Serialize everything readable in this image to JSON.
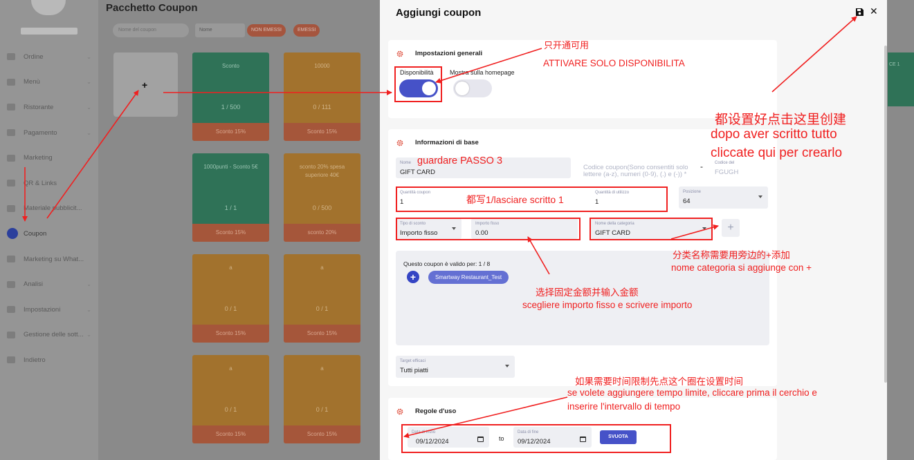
{
  "sidebar": {
    "items": [
      {
        "label": "Ordine",
        "chevron": true
      },
      {
        "label": "Menù",
        "chevron": true
      },
      {
        "label": "Ristorante",
        "chevron": true
      },
      {
        "label": "Pagamento",
        "chevron": true
      },
      {
        "label": "Marketing",
        "chevron": true
      },
      {
        "label": "QR & Links",
        "chevron": false
      },
      {
        "label": "Materiale pubblicit...",
        "chevron": false
      },
      {
        "label": "Coupon",
        "chevron": false,
        "active": true
      },
      {
        "label": "Marketing su What...",
        "chevron": false
      },
      {
        "label": "Analisi",
        "chevron": true
      },
      {
        "label": "Impostazioni",
        "chevron": true
      },
      {
        "label": "Gestione delle sott...",
        "chevron": true
      },
      {
        "label": "Indietro",
        "chevron": false
      }
    ],
    "chevron_glyph": "⌄"
  },
  "main": {
    "title": "Pacchetto Coupon",
    "search_placeholder": "Nome del coupon",
    "sort_value": "Nome",
    "chip_not_issued": "NON EMESSI",
    "chip_issued": "EMESSI",
    "add_card_plus": "+",
    "right_edge_title": "CE 1",
    "cards": [
      {
        "title": "Sconto",
        "count": "1 / 500",
        "bottom": "Sconto 15%",
        "color": "green"
      },
      {
        "title": "10000",
        "count": "0 / 111",
        "bottom": "Sconto 15%",
        "color": "orange"
      },
      {
        "title": "1000punti - Sconto 5€",
        "count": "1 / 1",
        "bottom": "Sconto 15%",
        "color": "green"
      },
      {
        "title": "sconto 20% spesa superiore 40€",
        "count": "0 / 500",
        "bottom": "sconto 20%",
        "color": "orange"
      },
      {
        "title": "a",
        "count": "0 / 1",
        "bottom": "Sconto 15%",
        "color": "orange"
      },
      {
        "title": "a",
        "count": "0 / 1",
        "bottom": "Sconto 15%",
        "color": "orange"
      },
      {
        "title": "a",
        "count": "0 / 1",
        "bottom": "Sconto 15%",
        "color": "orange"
      },
      {
        "title": "a",
        "count": "0 / 1",
        "bottom": "Sconto 15%",
        "color": "orange"
      }
    ]
  },
  "drawer": {
    "title": "Aggiungi coupon",
    "close": "✕",
    "general": {
      "title": "Impostazioni generali",
      "availability_label": "Disponibilità",
      "homepage_label": "Mostra sulla homepage"
    },
    "basic": {
      "title": "Informazioni di base",
      "name_label": "Nome",
      "name_value": "GIFT CARD",
      "code_placeholder_line1": "Codice coupon(Sono consentiti solo",
      "code_placeholder_line2": "lettere (a-z), numeri (0-9), (.) e (-)) *",
      "dash": "-",
      "code_suffix_label": "Codice del",
      "code_suffix_value": "FGUGH",
      "quantity_label": "Quantità coupon",
      "quantity_value": "1",
      "usage_label": "Quantità di utilizzo",
      "usage_value": "1",
      "position_label": "Posizione",
      "position_value": "64",
      "discount_type_label": "Tipo di sconto",
      "discount_type_value": "Importo fisso",
      "fixed_amount_label": "Importo fisso",
      "fixed_amount_value": "0.00",
      "category_label": "Nome della categoria",
      "category_value": "GIFT CARD",
      "add_category": "+",
      "valid_for": "Questo coupon è valido per: 1 / 8",
      "valid_add": "+",
      "restaurant_chip": "Smartway Restaurant_Test",
      "target_label": "Target efficaci",
      "target_value": "Tutti piatti"
    },
    "rules": {
      "title": "Regole d'uso",
      "start_label": "Data di inizio",
      "start_value": "09/12/2024",
      "to": "to",
      "end_label": "Data di fine",
      "end_value": "09/12/2024",
      "clear_button": "SVUOTA"
    }
  },
  "annotations": {
    "only_open_zh": "只开通可用",
    "only_open_it": "ATTIVARE SOLO DISPONIBILITA",
    "create_zh": "都设置好点击这里创建",
    "create_it_1": "dopo aver scritto tutto",
    "create_it_2": "cliccate qui per crearlo",
    "step3": "guardare PASSO 3",
    "write1": "都写1/lasciare scritto 1",
    "category_zh": "分类名称需要用旁边的+添加",
    "category_it": "nome categoria si aggiunge con +",
    "fixed_zh": "选择固定金额并输入金额",
    "fixed_it": "scegliere importo fisso e scrivere importo",
    "time_zh": "如果需要时间限制先点这个圈在设置时间",
    "time_it_1": "se volete aggiungere tempo limite, cliccare prima il cerchio e",
    "time_it_2": "inserire l'intervallo di tempo"
  },
  "colors": {
    "accent": "#4652c8",
    "annotation": "#f02020",
    "card_green": "#2f7257",
    "card_orange": "#a2722d"
  }
}
